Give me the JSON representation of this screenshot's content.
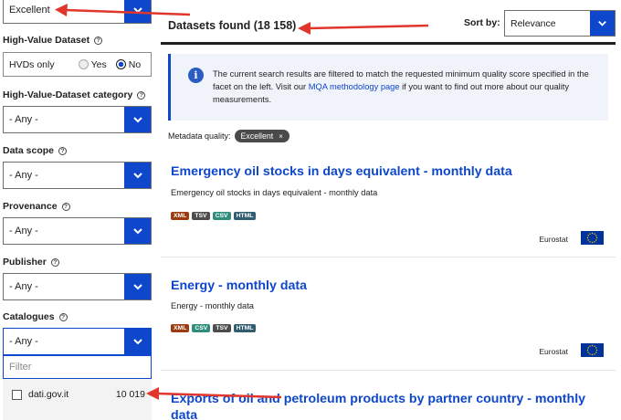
{
  "sidebar": {
    "quality_select": {
      "value": "Excellent"
    },
    "hvd": {
      "label": "High-Value Dataset",
      "hvds_only": "HVDs only",
      "yes": "Yes",
      "no": "No",
      "selected": "No"
    },
    "facets": [
      {
        "label": "High-Value-Dataset category",
        "value": "- Any -"
      },
      {
        "label": "Data scope",
        "value": "- Any -"
      },
      {
        "label": "Provenance",
        "value": "- Any -"
      },
      {
        "label": "Publisher",
        "value": "- Any -"
      },
      {
        "label": "Catalogues",
        "value": "- Any -"
      }
    ],
    "filter": {
      "placeholder": "Filter"
    },
    "catalogue_options": [
      {
        "name": "dati.gov.it",
        "count": "10 019"
      }
    ]
  },
  "main": {
    "results_title": "Datasets found (18 158)",
    "sort": {
      "label": "Sort by:",
      "value": "Relevance"
    },
    "info": {
      "text_before": "The current search results are filtered to match the requested minimum quality score specified in the facet on the left. Visit our ",
      "link": "MQA methodology page",
      "text_after": " if you want to find out more about our quality measurements."
    },
    "metadata_quality": {
      "label": "Metadata quality:",
      "chip": "Excellent",
      "chip_close": "×"
    },
    "datasets": [
      {
        "title": "Emergency oil stocks in days equivalent - monthly data",
        "description": "Emergency oil stocks in days equivalent - monthly data",
        "formats": [
          "XML",
          "TSV",
          "CSV",
          "HTML"
        ],
        "publisher": "Eurostat"
      },
      {
        "title": "Energy - monthly data",
        "description": "Energy - monthly data",
        "formats": [
          "XML",
          "CSV",
          "TSV",
          "HTML"
        ],
        "publisher": "Eurostat"
      },
      {
        "title": "Exports of oil and petroleum products by partner country - monthly",
        "title_line2": "data"
      }
    ]
  },
  "colors": {
    "accent": "#0e47cb",
    "annotation_arrow": "#e0362b",
    "fmt_XML": "#9b3c10",
    "fmt_TSV": "#4d4d4d",
    "fmt_CSV": "#2f8e7b",
    "fmt_HTML": "#315d70"
  },
  "icons": {
    "chevron": "chevron-down-icon",
    "help": "help-circle-icon",
    "info": "info-icon",
    "flag": "eu-flag-icon",
    "arrow": "red-arrow-annotation"
  }
}
